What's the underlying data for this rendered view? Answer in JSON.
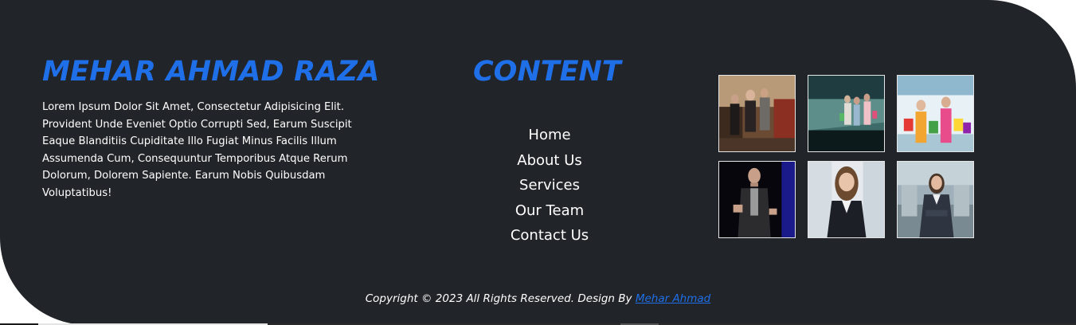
{
  "about": {
    "title": "MEHAR AHMAD RAZA",
    "text": "Lorem Ipsum Dolor Sit Amet, Consectetur Adipisicing Elit. Provident Unde Eveniet Optio Corrupti Sed, Earum Suscipit Eaque Blanditiis Cupiditate Illo Fugiat Minus Facilis Illum Assumenda Cum, Consequuntur Temporibus Atque Rerum Dolorum, Dolorem Sapiente. Earum Nobis Quibusdam Voluptatibus!"
  },
  "content": {
    "title": "CONTENT",
    "links": [
      "Home",
      "About Us",
      "Services",
      "Our Team",
      "Contact Us"
    ]
  },
  "gallery": {
    "images": [
      "shopping-crowd-photo",
      "mall-shoppers-photo",
      "shopping-bags-women-photo",
      "speaker-man-photo",
      "business-woman-photo",
      "business-woman-office-photo"
    ]
  },
  "footer": {
    "copyright": "Copyright © 2023 All Rights Reserved. Design By",
    "designer": "Mehar Ahmad"
  },
  "colors": {
    "background": "#212428",
    "accent": "#1f6fe8",
    "text": "#ffffff"
  }
}
